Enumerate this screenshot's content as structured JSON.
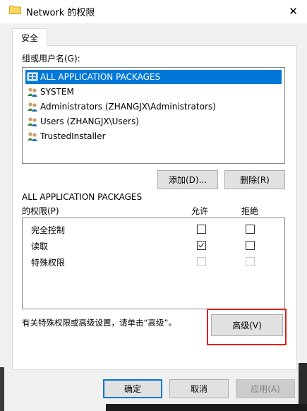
{
  "window": {
    "title": "Network 的权限",
    "close_glyph": "✕"
  },
  "tabs": [
    {
      "label": "安全",
      "active": true
    }
  ],
  "group_section": {
    "label": "组或用户名(G):",
    "items": [
      {
        "label": "ALL APPLICATION PACKAGES",
        "selected": true,
        "icon": "app-packages-icon"
      },
      {
        "label": "SYSTEM",
        "selected": false,
        "icon": "users-icon"
      },
      {
        "label": "Administrators (ZHANGJX\\Administrators)",
        "selected": false,
        "icon": "users-icon"
      },
      {
        "label": "Users (ZHANGJX\\Users)",
        "selected": false,
        "icon": "users-icon"
      },
      {
        "label": "TrustedInstaller",
        "selected": false,
        "icon": "users-icon"
      }
    ]
  },
  "buttons": {
    "add": "添加(D)...",
    "remove": "删除(R)",
    "advanced": "高级(V)",
    "ok": "确定",
    "cancel": "取消",
    "apply": "应用(A)"
  },
  "permissions": {
    "subject": "ALL APPLICATION PACKAGES",
    "label": "的权限(P)",
    "allow_header": "允许",
    "deny_header": "拒绝",
    "rows": [
      {
        "name": "完全控制",
        "allow": false,
        "deny": false,
        "disabled": false
      },
      {
        "name": "读取",
        "allow": true,
        "deny": false,
        "disabled": false
      },
      {
        "name": "特殊权限",
        "allow": false,
        "deny": false,
        "disabled": true
      }
    ]
  },
  "advanced_note": "有关特殊权限或高级设置，请单击“高级”。",
  "colors": {
    "selection": "#0078d7",
    "highlight_frame": "#e02020"
  }
}
